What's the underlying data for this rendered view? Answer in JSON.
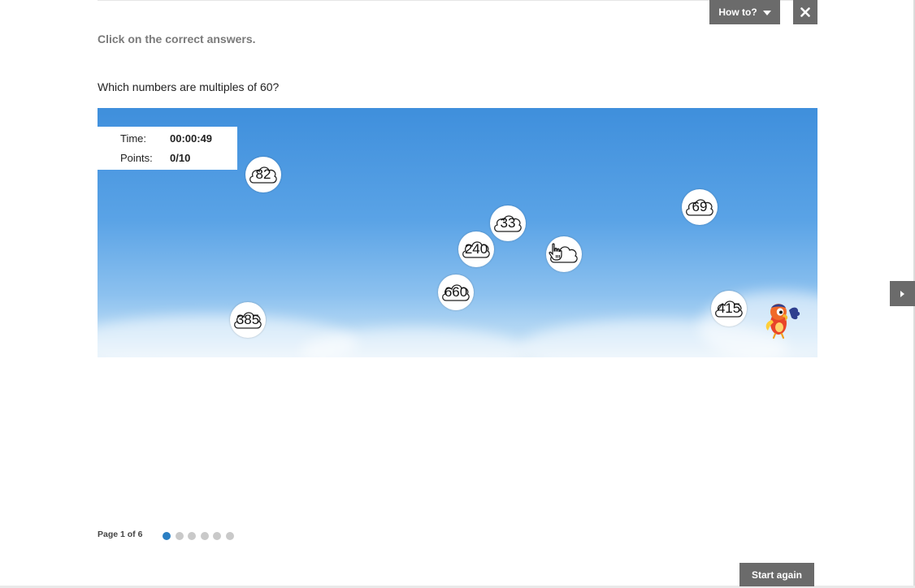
{
  "header": {
    "how_to_label": "How to?",
    "close_icon": "close-icon",
    "caret_icon": "caret-down-icon"
  },
  "instruction": "Click on the correct answers.",
  "question": "Which numbers are multiples of 60?",
  "stats": {
    "time_label": "Time:",
    "time_value": "00:00:49",
    "points_label": "Points:",
    "points_value": "0/10"
  },
  "bubbles": [
    "82",
    "33",
    "240",
    "",
    "69",
    "660",
    "415",
    "385"
  ],
  "footer": {
    "page_label": "Page 1 of 6",
    "total_pages": 6,
    "current_page": 1,
    "start_again_label": "Start again"
  },
  "colors": {
    "button_gray": "#6b6b6b",
    "dot_active": "#2b7fc3",
    "dot_inactive": "#c9c9c9",
    "sky_top": "#3f8fdc",
    "sky_bottom": "#dcecf8"
  }
}
